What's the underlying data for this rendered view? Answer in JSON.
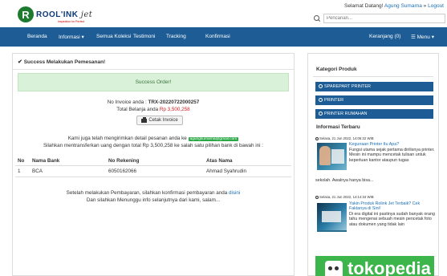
{
  "header": {
    "logo_letter": "R",
    "logo_text": "ROOL'INK",
    "logo_script": "jet",
    "logo_tagline": "Inspiration for Perfect",
    "welcome_prefix": "Selamat Datang!",
    "user_name": "Agung Sumarna",
    "logout_separator": "»",
    "logout_label": "Logout",
    "search_placeholder": "Pencarian..."
  },
  "nav": {
    "items": [
      "Beranda",
      "Informasi ▾",
      "Semua Koleksi",
      "Testimoni",
      "Tracking",
      "Konfirmasi"
    ],
    "cart": "Keranjang (0)",
    "menu": "☰ Menu ▾"
  },
  "main": {
    "success_check": "✔",
    "success_heading": "Success Melakukan Pemesanan!",
    "alert": "Success Order!",
    "invoice_label": "No Invoice anda :",
    "invoice_no": "TRX-20220722000257",
    "total_label": "Total Belanja anda",
    "total_value": "Rp 3,500,258",
    "print_button": "Cetak Invoice",
    "email_sent_prefix": "Kami juga telah mengirimkan detail pesanan anda ke",
    "email": "agungsumarna@gmail.com",
    "transfer_prefix": "Silahkan mentransferkan uang dengan total",
    "transfer_amount": "Rp 3,500,258",
    "transfer_suffix": "ke salah satu pilihan bank di bawah ini :",
    "table_headers": [
      "No",
      "Nama Bank",
      "No Rekening",
      "Atas Nama"
    ],
    "table_rows": [
      [
        "1",
        "BCA",
        "6050162066",
        "Ahmad Syahrudin"
      ]
    ],
    "after_payment_prefix": "Setelah melakukan Pembayaran, silahkan konfirmasi pembayaran anda",
    "after_payment_link": "disini",
    "wait_text": "Dan silahkan Menunggu info selanjutnya dari kami, salam..."
  },
  "sidebar": {
    "category_heading": "Kategori Produk",
    "categories": [
      "SPAREPART PRINTER",
      "PRINTER",
      "PRINTER RUMAHAN"
    ],
    "news_heading": "Informasi Terbaru",
    "posts": [
      {
        "meta": "Selasa, 21 Jun 2022, 14:06:22 WIB",
        "title": "Kegunaan Printer Itu Apa?",
        "text": "Fungsi utama sejak pertama dirilisnya printer. Mesin ini mampu mencetak tulisan untuk keperluan kantor ataupun tugas",
        "cont": "sekolah. Awalnya hanya bisa..."
      },
      {
        "meta": "Selasa, 21 Jun 2022, 14:14:34 WIB",
        "title": "Yakin Produk Rolink Jet Terbaik? Cek Faktanya di Sini!",
        "text": "Di era digital ini pastinya sudah banyak orang tahu mengenai sebuah mesin pencetak foto atau dokumen yang tidak lain"
      }
    ],
    "marketplace": "tokopedia"
  },
  "colors": {
    "nav": "#1d5c94",
    "accent_red": "#d0191e",
    "success_bg": "#d9f1d8",
    "link": "#1a6fb5"
  }
}
